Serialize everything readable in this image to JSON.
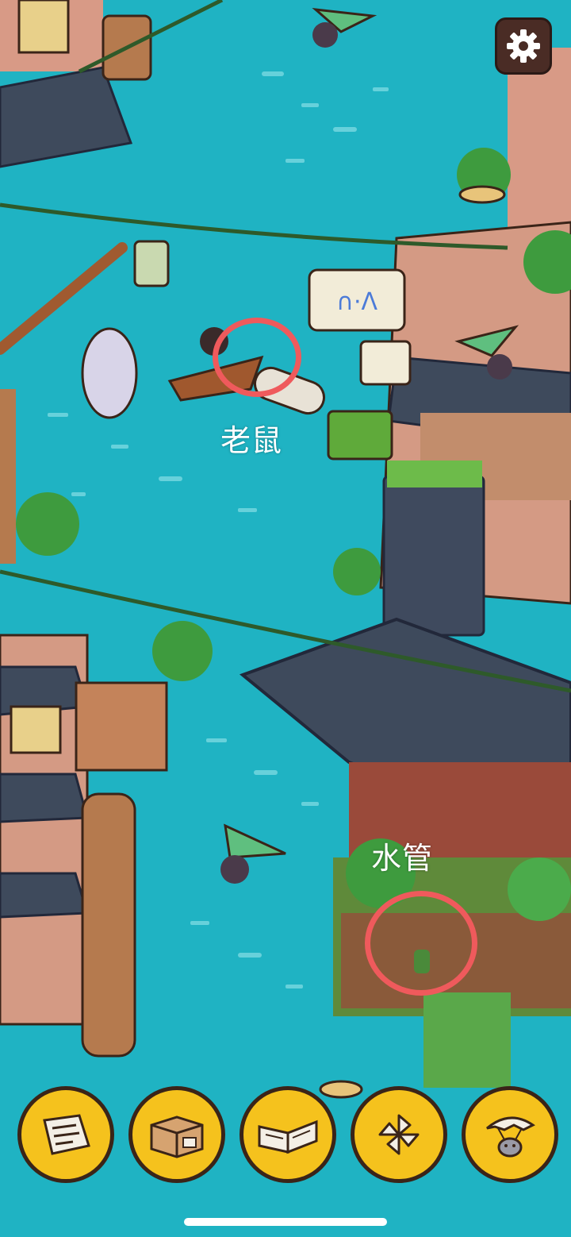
{
  "hints": {
    "rat_label": "老鼠",
    "pipe_label": "水管"
  },
  "toolbar": {
    "items": [
      {
        "icon": "letter-icon"
      },
      {
        "icon": "box-icon"
      },
      {
        "icon": "book-icon"
      },
      {
        "icon": "pinwheel-icon"
      },
      {
        "icon": "rat-glider-icon"
      }
    ]
  },
  "colors": {
    "water": "#1fb3c3",
    "marker": "#ef5a5c",
    "toolbar_button": "#f5c21d",
    "settings_bg": "#4a2c25"
  }
}
